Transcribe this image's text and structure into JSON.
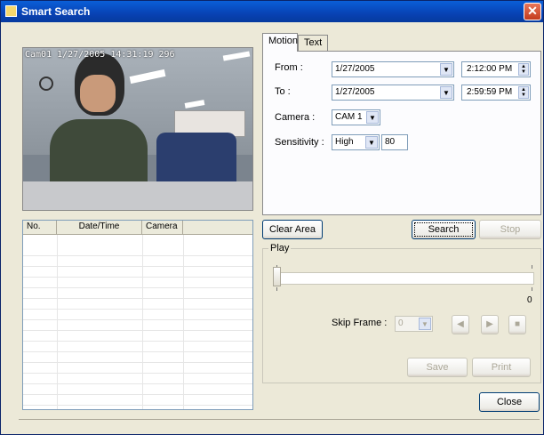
{
  "window": {
    "title": "Smart Search",
    "close_glyph": "✕"
  },
  "video": {
    "osd": "Cam01 1/27/2005 14:31:19 296"
  },
  "tabs": [
    {
      "label": "Motion"
    },
    {
      "label": "Text"
    }
  ],
  "motion": {
    "from_label": "From :",
    "from_date": "1/27/2005",
    "from_time": "2:12:00 PM",
    "to_label": "To :",
    "to_date": "1/27/2005",
    "to_time": "2:59:59 PM",
    "camera_label": "Camera :",
    "camera_value": "CAM 1",
    "sensitivity_label": "Sensitivity :",
    "sensitivity_value": "High",
    "sensitivity_number": "80"
  },
  "results": {
    "columns": [
      "No.",
      "Date/Time",
      "Camera",
      ""
    ]
  },
  "buttons": {
    "clear_area": "Clear Area",
    "search": "Search",
    "stop": "Stop",
    "save": "Save",
    "print": "Print",
    "close": "Close"
  },
  "play": {
    "group_label": "Play",
    "slider_max": "0",
    "skip_frame_label": "Skip Frame :",
    "skip_frame_value": "0",
    "prev_glyph": "◀",
    "next_glyph": "▶",
    "stop_glyph": "■"
  },
  "icons": [
    "app-icon",
    "close-icon",
    "dropdown-arrow-icon",
    "spin-updown-icon",
    "prev-frame-icon",
    "next-frame-icon",
    "stop-icon"
  ]
}
